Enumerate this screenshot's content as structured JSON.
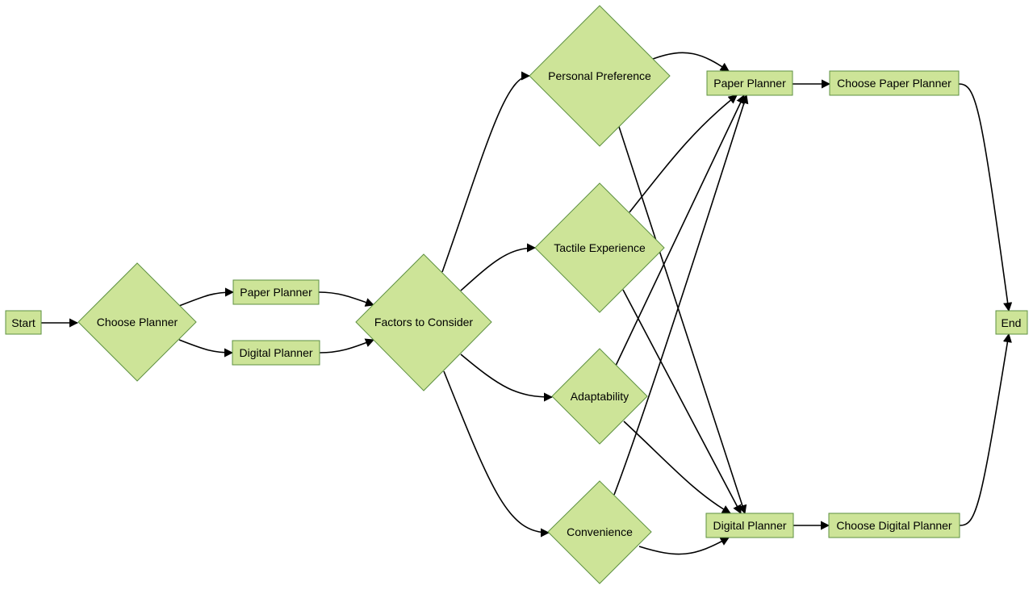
{
  "colors": {
    "node_fill": "#cde498",
    "node_stroke": "#5e9142",
    "edge": "#000000"
  },
  "nodes": {
    "start": "Start",
    "choose_planner": "Choose Planner",
    "paper_planner_1": "Paper Planner",
    "digital_planner_1": "Digital Planner",
    "factors": "Factors to Consider",
    "personal_preference": "Personal Preference",
    "tactile_experience": "Tactile Experience",
    "adaptability": "Adaptability",
    "convenience": "Convenience",
    "paper_planner_2": "Paper Planner",
    "digital_planner_2": "Digital Planner",
    "choose_paper": "Choose Paper Planner",
    "choose_digital": "Choose Digital Planner",
    "end": "End"
  },
  "edges": [
    [
      "start",
      "choose_planner"
    ],
    [
      "choose_planner",
      "paper_planner_1"
    ],
    [
      "choose_planner",
      "digital_planner_1"
    ],
    [
      "paper_planner_1",
      "factors"
    ],
    [
      "digital_planner_1",
      "factors"
    ],
    [
      "factors",
      "personal_preference"
    ],
    [
      "factors",
      "tactile_experience"
    ],
    [
      "factors",
      "adaptability"
    ],
    [
      "factors",
      "convenience"
    ],
    [
      "personal_preference",
      "paper_planner_2"
    ],
    [
      "personal_preference",
      "digital_planner_2"
    ],
    [
      "tactile_experience",
      "paper_planner_2"
    ],
    [
      "tactile_experience",
      "digital_planner_2"
    ],
    [
      "adaptability",
      "paper_planner_2"
    ],
    [
      "adaptability",
      "digital_planner_2"
    ],
    [
      "convenience",
      "paper_planner_2"
    ],
    [
      "convenience",
      "digital_planner_2"
    ],
    [
      "paper_planner_2",
      "choose_paper"
    ],
    [
      "digital_planner_2",
      "choose_digital"
    ],
    [
      "choose_paper",
      "end"
    ],
    [
      "choose_digital",
      "end"
    ]
  ]
}
